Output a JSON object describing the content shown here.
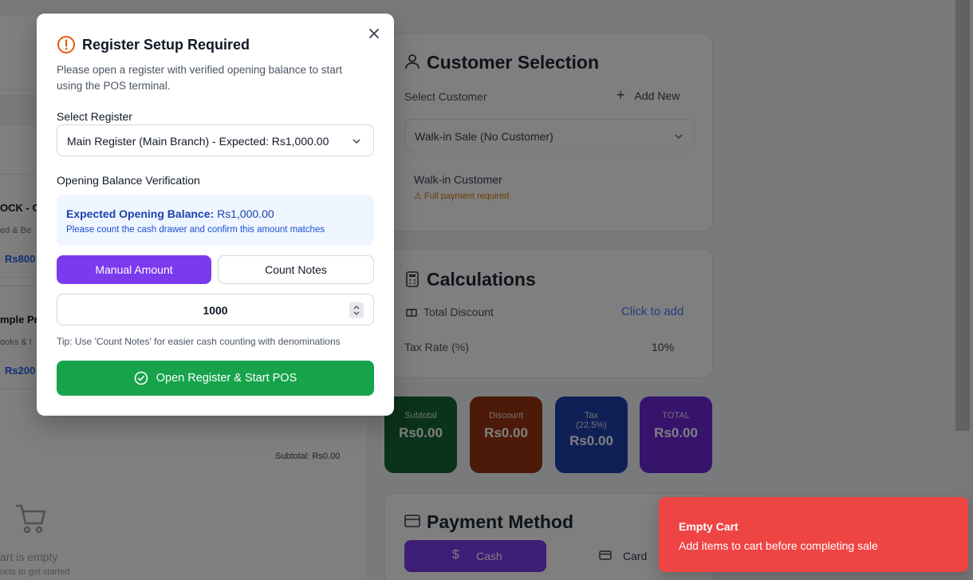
{
  "background": {
    "products": [
      {
        "name": "OCK - C",
        "category": "ed & Be",
        "price": "Rs800"
      },
      {
        "name": "mple Pro",
        "category": "ooks & I",
        "price": "Rs200"
      }
    ],
    "cart": {
      "subtotal": "Subtotal: Rs0.00",
      "empty_text": "art is empty",
      "empty_sub": "ucts to get started"
    },
    "customer": {
      "title": "Customer Selection",
      "select_label": "Select Customer",
      "add_new": "Add New",
      "selected": "Walk-in Sale (No Customer)",
      "walkin_name": "Walk-in Customer",
      "walkin_note": "⚠ Full payment required"
    },
    "calculations": {
      "title": "Calculations",
      "discount_label": "Total Discount",
      "discount_action": "Click to add",
      "tax_label": "Tax Rate (%)",
      "tax_value": "10%"
    },
    "stats": [
      {
        "label": "Subtotal",
        "value": "Rs0.00",
        "color": "#166534"
      },
      {
        "label": "Discount",
        "value": "Rs0.00",
        "color": "#9a3412"
      },
      {
        "label": "Tax",
        "sub": "(22.5%)",
        "value": "Rs0.00",
        "color": "#1e40af"
      },
      {
        "label": "TOTAL",
        "value": "Rs0.00",
        "color": "#6d28d9"
      }
    ],
    "payment": {
      "title": "Payment Method",
      "cash": "Cash",
      "card": "Card"
    }
  },
  "modal": {
    "title": "Register Setup Required",
    "description": "Please open a register with verified opening balance to start using the POS terminal.",
    "select_register_label": "Select Register",
    "selected_register": "Main Register (Main Branch) - Expected: Rs1,000.00",
    "verification_label": "Opening Balance Verification",
    "expected_label": "Expected Opening Balance:",
    "expected_value": "Rs1,000.00",
    "expected_hint": "Please count the cash drawer and confirm this amount matches",
    "tabs": {
      "manual": "Manual Amount",
      "count": "Count Notes"
    },
    "amount_value": "1000",
    "tip": "Tip: Use 'Count Notes' for easier cash counting with denominations",
    "submit": "Open Register & Start POS"
  },
  "toast": {
    "title": "Empty Cart",
    "message": "Add items to cart before completing sale",
    "color": "#ef4444"
  }
}
